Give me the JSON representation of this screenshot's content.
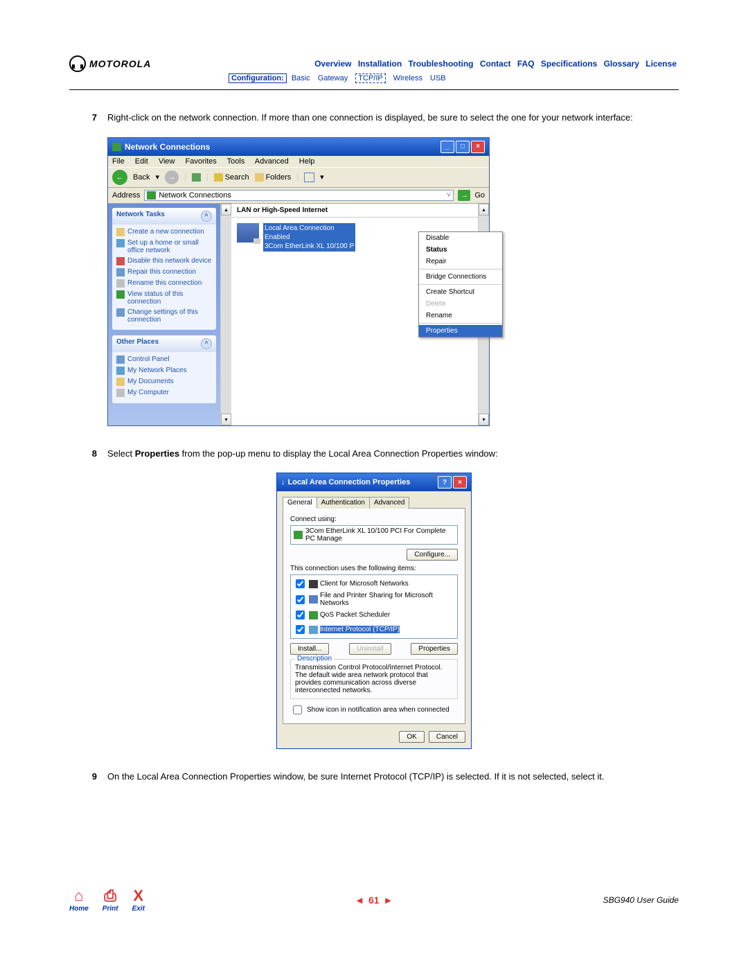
{
  "brand": "MOTOROLA",
  "nav_top": [
    "Overview",
    "Installation",
    "Troubleshooting",
    "Contact",
    "FAQ",
    "Specifications",
    "Glossary",
    "License"
  ],
  "nav_sub": {
    "config": "Configuration:",
    "items": [
      "Basic",
      "Gateway",
      "TCP/IP",
      "Wireless",
      "USB"
    ]
  },
  "steps": {
    "s7": {
      "num": "7",
      "text_a": "Right-click on the network connection. If more than one connection is displayed, be sure to select the one for your network interface:"
    },
    "s8": {
      "num": "8",
      "text_a": "Select ",
      "bold": "Properties",
      "text_b": " from the pop-up menu to display the Local Area Connection Properties window:"
    },
    "s9": {
      "num": "9",
      "text_a": "On the Local Area Connection Properties window, be sure Internet Protocol (TCP/IP) is selected. If it is not selected, select it."
    }
  },
  "xp": {
    "title": "Network Connections",
    "menu": [
      "File",
      "Edit",
      "View",
      "Favorites",
      "Tools",
      "Advanced",
      "Help"
    ],
    "toolbar": {
      "back": "Back",
      "search": "Search",
      "folders": "Folders"
    },
    "addr_label": "Address",
    "addr_value": "Network Connections",
    "go": "Go",
    "side": {
      "panel1": {
        "title": "Network Tasks",
        "items": [
          "Create a new connection",
          "Set up a home or small office network",
          "Disable this network device",
          "Repair this connection",
          "Rename this connection",
          "View status of this connection",
          "Change settings of this connection"
        ]
      },
      "panel2": {
        "title": "Other Places",
        "items": [
          "Control Panel",
          "My Network Places",
          "My Documents",
          "My Computer"
        ]
      }
    },
    "main": {
      "heading": "LAN or High-Speed Internet",
      "item": {
        "name": "Local Area Connection",
        "status": "Enabled",
        "adapter": "3Com EtherLink XL 10/100 P"
      }
    },
    "ctx": [
      "Disable",
      "Status",
      "Repair",
      "Bridge Connections",
      "Create Shortcut",
      "Delete",
      "Rename",
      "Properties"
    ]
  },
  "props": {
    "title": "Local Area Connection Properties",
    "tabs": [
      "General",
      "Authentication",
      "Advanced"
    ],
    "connect_using": "Connect using:",
    "adapter": "3Com EtherLink XL 10/100 PCI For Complete PC Manage",
    "configure": "Configure...",
    "uses_label": "This connection uses the following items:",
    "items": [
      "Client for Microsoft Networks",
      "File and Printer Sharing for Microsoft Networks",
      "QoS Packet Scheduler",
      "Internet Protocol (TCP/IP)"
    ],
    "install": "Install...",
    "uninstall": "Uninstall",
    "properties": "Properties",
    "desc_title": "Description",
    "desc": "Transmission Control Protocol/Internet Protocol. The default wide area network protocol that provides communication across diverse interconnected networks.",
    "show_icon": "Show icon in notification area when connected",
    "ok": "OK",
    "cancel": "Cancel"
  },
  "footer": {
    "home": "Home",
    "print": "Print",
    "exit": "Exit",
    "page": "61",
    "guide": "SBG940 User Guide"
  }
}
